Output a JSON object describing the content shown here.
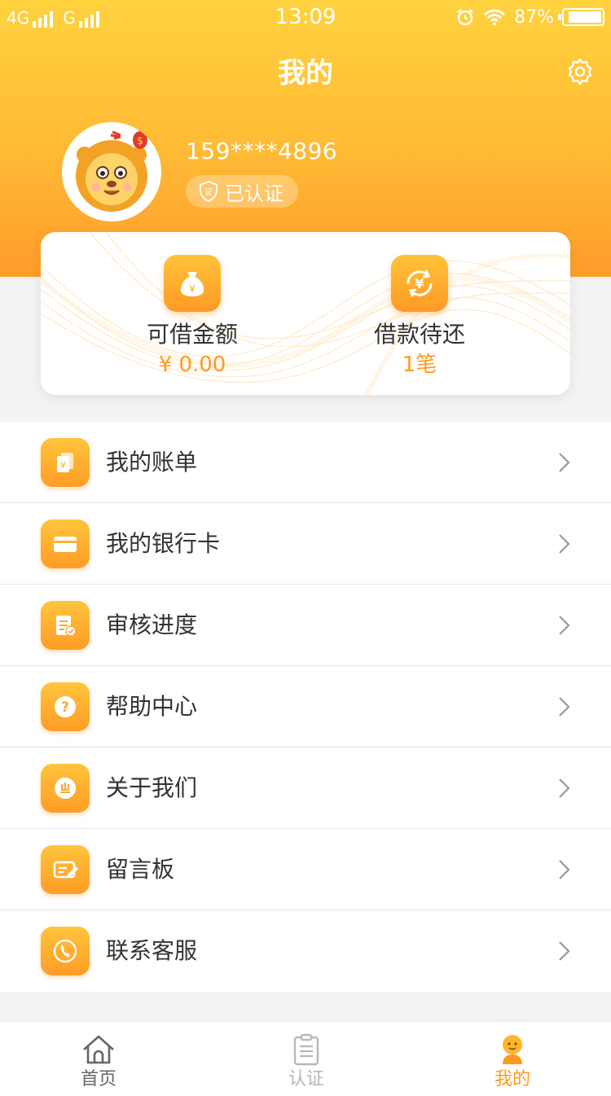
{
  "status_bar": {
    "network_1": "4G",
    "network_2": "G",
    "time": "13:09",
    "battery": "87%"
  },
  "header": {
    "title": "我的",
    "settings_icon": "gear-icon"
  },
  "profile": {
    "phone": "159****4896",
    "verified_label": "已认证",
    "avatar": "lion-mascot-avatar"
  },
  "loan_card": {
    "available_label": "可借金额",
    "available_value": "¥ 0.00",
    "pending_label": "借款待还",
    "pending_value": "1笔"
  },
  "menu": [
    {
      "label": "我的账单",
      "icon": "bill-icon"
    },
    {
      "label": "我的银行卡",
      "icon": "bank-card-icon"
    },
    {
      "label": "审核进度",
      "icon": "review-progress-icon"
    },
    {
      "label": "帮助中心",
      "icon": "help-icon"
    },
    {
      "label": "关于我们",
      "icon": "about-icon"
    },
    {
      "label": "留言板",
      "icon": "message-board-icon"
    },
    {
      "label": "联系客服",
      "icon": "phone-icon"
    }
  ],
  "tabbar": {
    "tabs": [
      {
        "label": "首页",
        "icon": "home-icon"
      },
      {
        "label": "认证",
        "icon": "clipboard-icon"
      },
      {
        "label": "我的",
        "icon": "user-icon",
        "active": true
      }
    ]
  },
  "colors": {
    "accent": "#ff9a1f",
    "header_top": "#ffd23e",
    "header_bottom": "#ff9c2a"
  }
}
